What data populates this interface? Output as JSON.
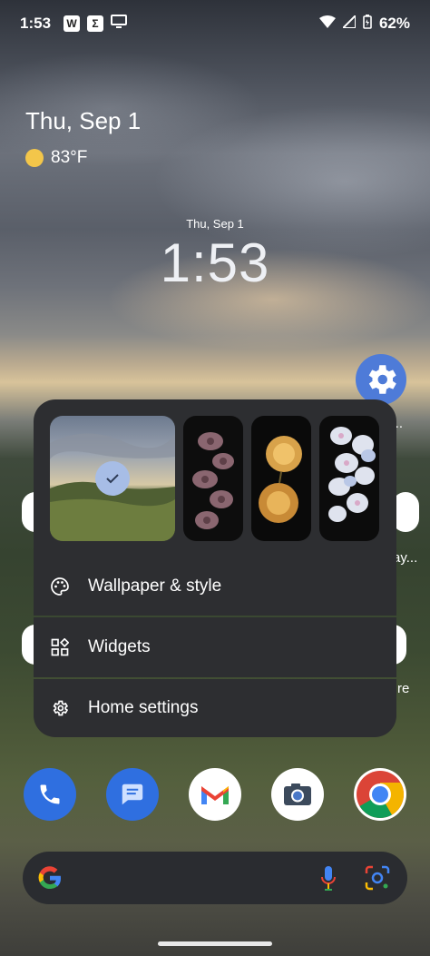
{
  "status_bar": {
    "time": "1:53",
    "notification_icons": [
      "W",
      "Σ",
      "screen-icon"
    ],
    "battery_percent": "62%"
  },
  "glance": {
    "date": "Thu, Sep 1",
    "temperature": "83°F"
  },
  "clock": {
    "date": "Thu, Sep 1",
    "time": "1:53"
  },
  "settings_app": {
    "label_fragment": "ti..."
  },
  "partial_labels": {
    "right_middle": "ay...",
    "right_lower": "re"
  },
  "popup_menu": {
    "wallpaper_selected": 1,
    "items": [
      {
        "label": "Wallpaper & style",
        "icon": "palette-icon"
      },
      {
        "label": "Widgets",
        "icon": "widgets-icon"
      },
      {
        "label": "Home settings",
        "icon": "gear-icon"
      }
    ]
  },
  "dock": {
    "apps": [
      "phone",
      "messages",
      "gmail",
      "camera",
      "chrome"
    ]
  },
  "search_bar": {
    "icons": [
      "google-icon",
      "mic-icon",
      "lens-icon"
    ]
  },
  "colors": {
    "popup_bg": "#2d2e31",
    "accent_blue": "#4e7bd8",
    "check_bg": "#a7bde6"
  }
}
